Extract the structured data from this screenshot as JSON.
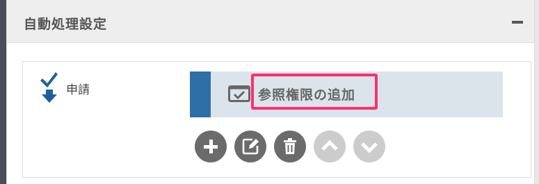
{
  "panel": {
    "title": "自動処理設定",
    "collapse_icon": "minus-icon"
  },
  "event": {
    "label": "申請",
    "icon": "arrow-down-check-icon"
  },
  "action": {
    "label": "参照権限の追加",
    "icon": "checkbox-window-icon",
    "highlighted": true
  },
  "buttons": [
    {
      "name": "add",
      "icon": "plus-icon",
      "enabled": true
    },
    {
      "name": "edit",
      "icon": "edit-icon",
      "enabled": true
    },
    {
      "name": "delete",
      "icon": "trash-icon",
      "enabled": true
    },
    {
      "name": "move-up",
      "icon": "chevron-up-icon",
      "enabled": false
    },
    {
      "name": "move-down",
      "icon": "chevron-down-icon",
      "enabled": false
    }
  ],
  "colors": {
    "accent_stripe": "#2f6fa8",
    "action_row_bg": "#dce4eb",
    "highlight_border": "#ff2f6f",
    "enabled_button": "#6b6b6b",
    "disabled_button": "#cccccc",
    "event_icon": "#1f5f9e"
  }
}
